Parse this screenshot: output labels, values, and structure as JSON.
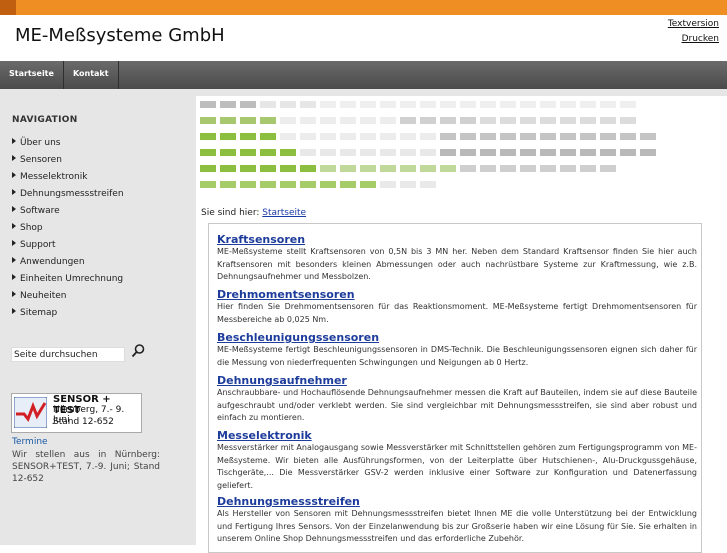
{
  "header": {
    "brand": "ME-Meßsysteme GmbH",
    "textversion": "Textversion",
    "print": "Drucken"
  },
  "navbar": {
    "items": [
      "Startseite",
      "Kontakt"
    ]
  },
  "sidebar": {
    "title": "NAVIGATION",
    "items": [
      "Über uns",
      "Sensoren",
      "Messelektronik",
      "Dehnungsmessstreifen",
      "Software",
      "Shop",
      "Support",
      "Anwendungen",
      "Einheiten Umrechnung",
      "Neuheiten",
      "Sitemap"
    ],
    "search_label": "Seite durchsuchen",
    "event": {
      "title": "SENSOR + TEST",
      "dates": "Nürnberg, 7.- 9. Juni",
      "stand": "Stand 12-652"
    },
    "termine_title": "Termine",
    "termine_text": "Wir stellen aus in Nürnberg: SENSOR+TEST, 7.-9. Juni; Stand 12-652"
  },
  "breadcrumb": {
    "prefix": "Sie sind hier:",
    "link": "Startseite"
  },
  "sections": [
    {
      "title": "Kraftsensoren",
      "text": "ME-Meßsysteme stellt Kraftsensoren von 0,5N bis 3 MN her. Neben dem Standard Kraftsensor finden Sie hier auch Kraftsensoren mit besonders kleinen Abmessungen oder auch nachrüstbare Systeme zur Kraftmessung, wie z.B. Dehnungsaufnehmer und Messbolzen."
    },
    {
      "title": "Drehmomentsensoren",
      "text": "Hier finden Sie Drehmomentsensoren für das Reaktionsmoment. ME-Meßsysteme fertigt Drehmomentsensoren für Messbereiche ab 0,025 Nm."
    },
    {
      "title": "Beschleunigungssensoren",
      "text": "ME-Meßsysteme fertigt Beschleunigungssensoren in DMS-Technik. Die Beschleunigungssensoren eignen sich daher für die Messung von niederfrequenten Schwingungen und Neigungen ab 0 Hertz."
    },
    {
      "title": "Dehnungsaufnehmer",
      "text": "Anschraubbare- und Hochauflösende Dehnungsaufnehmer messen die Kraft auf Bauteilen, indem sie auf diese Bauteile aufgeschraubt und/oder verklebt werden. Sie sind vergleichbar mit Dehnungsmessstreifen, sie sind aber robust und einfach zu montieren."
    },
    {
      "title": "Messelektronik",
      "text": "Messverstärker mit Analogausgang sowie Messverstärker mit Schnittstellen gehören zum Fertigungsprogramm von ME-Meßsysteme. Wir bieten alle Ausführungsformen, von der Leiterplatte über Hutschienen-, Alu-Druckgussgehäuse, Tischgeräte,... Die Messverstärker GSV-2 werden inklusive einer Software zur Konfiguration und Datenerfassung geliefert."
    },
    {
      "title": "Dehnungsmessstreifen",
      "text": "Als Hersteller von Sensoren mit Dehnungsmessstreifen bietet Ihnen ME die volle Unterstützung bei der Entwicklung und Fertigung Ihres Sensors. Von der Einzelanwendung bis zur Großserie haben wir eine Lösung für Sie. Sie erhalten in unserem Online Shop Dehnungsmessstreifen und das erforderliche Zubehör."
    }
  ],
  "colors": {
    "accent": "#ee8e23",
    "green": "#8cbf3f",
    "link": "#1d3c9b"
  }
}
